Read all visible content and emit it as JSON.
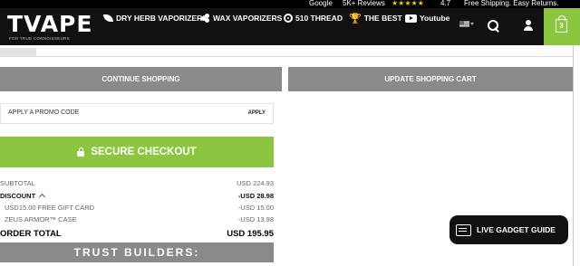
{
  "top_bar": {
    "google_label": "Google",
    "reviews_label": "5K+ Reviews",
    "stars": "★★★★★",
    "rating": "4.7",
    "shipping_text": "Free Shipping. Easy Returns."
  },
  "header": {
    "logo_text": "TVAPE",
    "logo_tagline": "FOR TRUE CONNOISSEURS",
    "nav": [
      {
        "label": "DRY HERB VAPORIZERS",
        "icon": "leaf-icon"
      },
      {
        "label": "WAX VAPORIZERS",
        "icon": "wax-drops-icon"
      },
      {
        "label": "510 THREAD",
        "icon": "thread-icon"
      },
      {
        "label": "THE BEST",
        "icon": "trophy-icon"
      },
      {
        "label": "Youtube",
        "icon": "youtube-icon"
      }
    ],
    "cart_count": "3",
    "accent_color": "#8cc540"
  },
  "cart_actions": {
    "continue_label": "CONTINUE SHOPPING",
    "update_label": "UPDATE SHOPPING CART"
  },
  "promo": {
    "placeholder": "APPLY A PROMO CODE",
    "apply_label": "APPLY"
  },
  "checkout": {
    "label": "SECURE CHECKOUT"
  },
  "totals": {
    "subtotal_label": "SUBTOTAL",
    "subtotal_value": "USD 224.93",
    "discount_label": "DISCOUNT",
    "discount_value": "-USD 28.98",
    "discount_items": [
      {
        "label": "USD15.00 FREE GIFT CARD",
        "value": "-USD 15.00"
      },
      {
        "label": "ZEUS ARMOR™ CASE",
        "value": "-USD 13.98"
      }
    ],
    "order_total_label": "ORDER TOTAL",
    "order_total_value": "USD 195.95"
  },
  "trust": {
    "title": "TRUST BUILDERS:"
  },
  "chat": {
    "label": "LIVE GADGET GUIDE"
  }
}
